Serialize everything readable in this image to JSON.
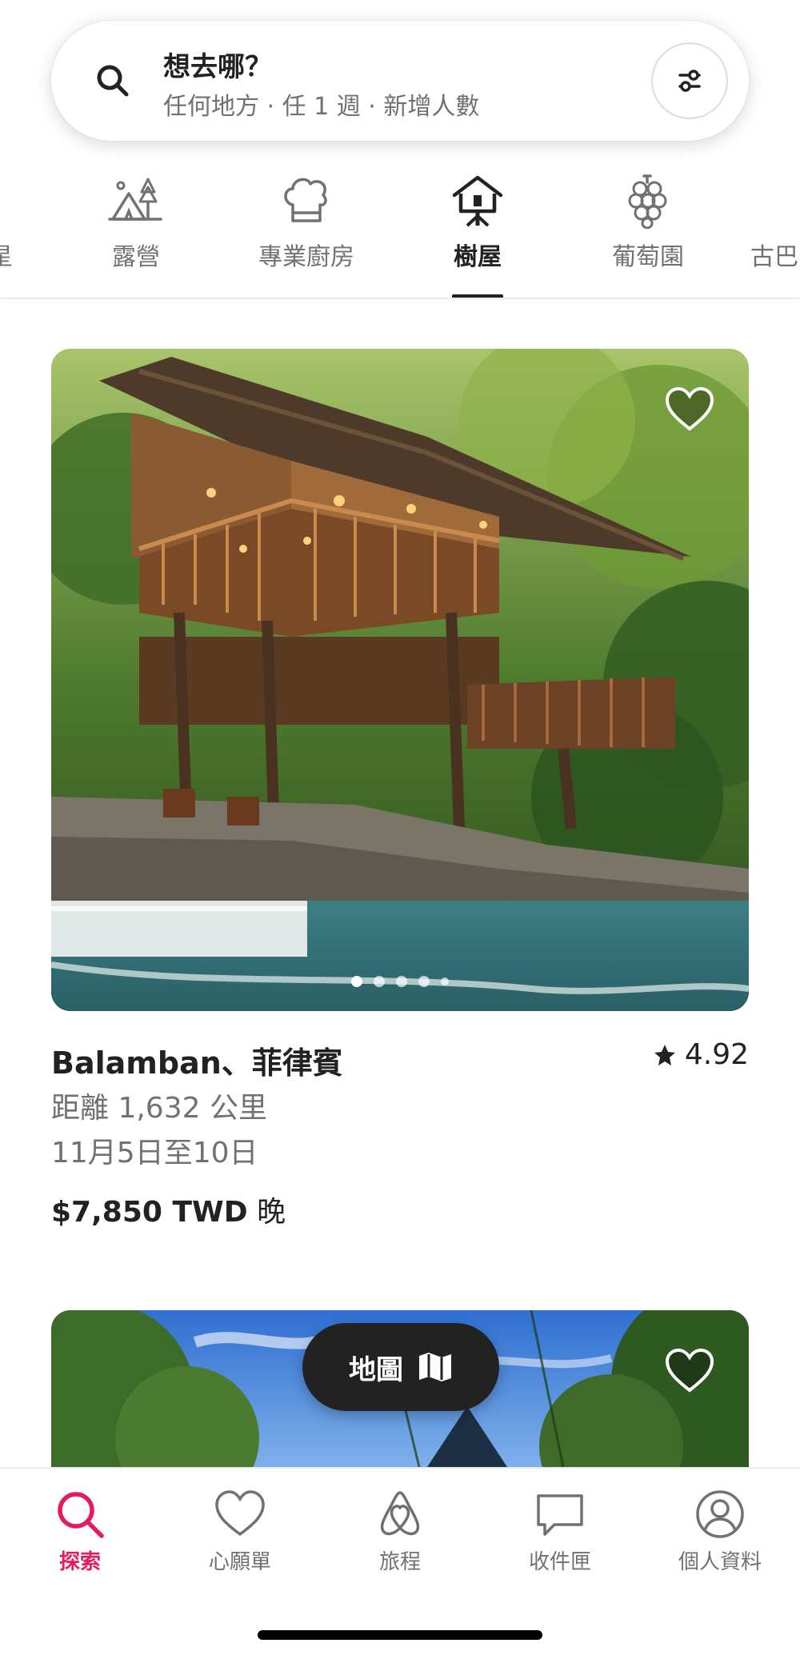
{
  "search": {
    "title": "想去哪？",
    "subtitle": "任何地方 · 任 1 週 · 新增人數"
  },
  "categories": {
    "partial_left": "星",
    "items": [
      {
        "label": "露營",
        "icon": "camping-tent-icon"
      },
      {
        "label": "專業廚房",
        "icon": "chef-hat-icon"
      },
      {
        "label": "樹屋",
        "icon": "treehouse-icon",
        "active": true
      },
      {
        "label": "葡萄園",
        "icon": "grapes-icon"
      }
    ],
    "partial_right": "古巴"
  },
  "listing": {
    "title": "Balamban、菲律賓",
    "rating": "4.92",
    "distance": "距離 1,632 公里",
    "dates": "11月5日至10日",
    "price": "$7,850 TWD",
    "price_unit": "晚",
    "photo_count": 5,
    "active_photo": 0
  },
  "map_button": {
    "label": "地圖",
    "icon": "map-icon"
  },
  "bottom_nav": [
    {
      "label": "探索",
      "icon": "search-icon",
      "active": true
    },
    {
      "label": "心願單",
      "icon": "heart-icon"
    },
    {
      "label": "旅程",
      "icon": "airbnb-logo-icon"
    },
    {
      "label": "收件匣",
      "icon": "message-icon"
    },
    {
      "label": "個人資料",
      "icon": "profile-icon"
    }
  ],
  "colors": {
    "accent": "#E31C5F",
    "text": "#222222",
    "secondary_text": "#717171"
  }
}
